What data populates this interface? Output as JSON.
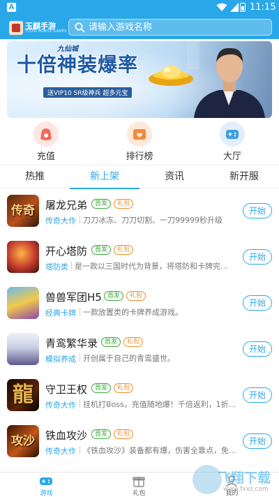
{
  "status_bar": {
    "notification_glyph": "A",
    "time": "11:15"
  },
  "header": {
    "logo_name": "玉麒手游",
    "logo_sub": "YUQIN MOBILE GAMES",
    "search_placeholder": "请输入游戏名称",
    "bg_color": "#2aa7e8"
  },
  "banner": {
    "brand": "九仙城",
    "headline": "十倍神装爆率",
    "tagline": "送VIP10 SR级神兵  超多元宝"
  },
  "quick_menu": [
    {
      "label": "充值",
      "icon": "wallet-icon",
      "color": "#f26b5b"
    },
    {
      "label": "排行榜",
      "icon": "ranking-icon",
      "color": "#f5883a"
    },
    {
      "label": "大厅",
      "icon": "gamepad-icon",
      "color": "#3b9ee6"
    }
  ],
  "tabs": [
    {
      "label": "热推",
      "active": false
    },
    {
      "label": "新上架",
      "active": true
    },
    {
      "label": "资讯",
      "active": false
    },
    {
      "label": "新开服",
      "active": false
    }
  ],
  "games": [
    {
      "title": "屠龙兄弟",
      "badges": [
        "首发",
        "礼包"
      ],
      "category": "传奇大作",
      "desc": "刀刀冰冻、刀刀切割、一刀99999秒升级",
      "button": "开始",
      "glyph": "传奇"
    },
    {
      "title": "开心塔防",
      "badges": [
        "首发",
        "礼包"
      ],
      "category": "塔防类",
      "desc": "是一款以三国时代为背景，将塔防和卡牌完美...",
      "button": "开始",
      "glyph": ""
    },
    {
      "title": "兽兽军团H5",
      "badges": [
        "首发",
        "礼包"
      ],
      "category": "经典卡牌",
      "desc": "一款放置类的卡牌养成游戏。",
      "button": "开始",
      "glyph": ""
    },
    {
      "title": "青鸾繁华录",
      "badges": [
        "首发",
        "礼包"
      ],
      "category": "模拟养成",
      "desc": "开创属于自己的青鸾盛世。",
      "button": "开始",
      "glyph": ""
    },
    {
      "title": "守卫王权",
      "badges": [
        "首发",
        "礼包"
      ],
      "category": "传奇大作",
      "desc": "挂机打Boss，充值随地爆！千倍返利，1折...",
      "button": "开始",
      "glyph": "龍"
    },
    {
      "title": "铁血攻沙",
      "badges": [
        "首发",
        "礼包"
      ],
      "category": "传奇大作",
      "desc": "《铁血攻沙》装备都有爆，伤害全靠点，免...",
      "button": "开始",
      "glyph": "攻沙"
    }
  ],
  "bottom_nav": [
    {
      "label": "游戏",
      "icon": "gamepad-icon",
      "active": true
    },
    {
      "label": "礼包",
      "icon": "gift-icon",
      "active": false
    },
    {
      "label": "我的",
      "icon": "profile-icon",
      "active": false
    }
  ],
  "watermark": {
    "text": "飞翔下载",
    "url": "www.fxxz.com"
  },
  "accent_color": "#2aa7e8"
}
